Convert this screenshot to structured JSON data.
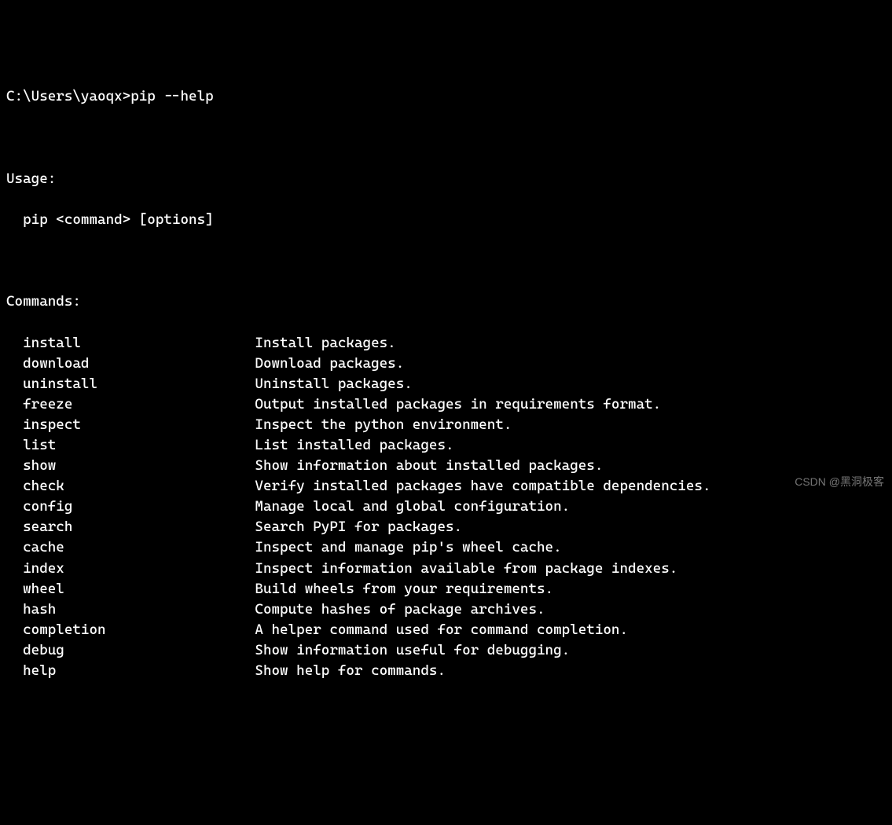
{
  "prompt": "C:\\Users\\yaoqx>pip --help",
  "usage_header": "Usage:",
  "usage_line": "pip <command> [options]",
  "commands_header": "Commands:",
  "commands": [
    {
      "name": "install",
      "desc": "Install packages."
    },
    {
      "name": "download",
      "desc": "Download packages."
    },
    {
      "name": "uninstall",
      "desc": "Uninstall packages."
    },
    {
      "name": "freeze",
      "desc": "Output installed packages in requirements format."
    },
    {
      "name": "inspect",
      "desc": "Inspect the python environment."
    },
    {
      "name": "list",
      "desc": "List installed packages."
    },
    {
      "name": "show",
      "desc": "Show information about installed packages."
    },
    {
      "name": "check",
      "desc": "Verify installed packages have compatible dependencies."
    },
    {
      "name": "config",
      "desc": "Manage local and global configuration."
    },
    {
      "name": "search",
      "desc": "Search PyPI for packages."
    },
    {
      "name": "cache",
      "desc": "Inspect and manage pip's wheel cache."
    },
    {
      "name": "index",
      "desc": "Inspect information available from package indexes."
    },
    {
      "name": "wheel",
      "desc": "Build wheels from your requirements."
    },
    {
      "name": "hash",
      "desc": "Compute hashes of package archives."
    },
    {
      "name": "completion",
      "desc": "A helper command used for command completion."
    },
    {
      "name": "debug",
      "desc": "Show information useful for debugging."
    },
    {
      "name": "help",
      "desc": "Show help for commands."
    }
  ],
  "watermark": "CSDN @黑洞极客"
}
